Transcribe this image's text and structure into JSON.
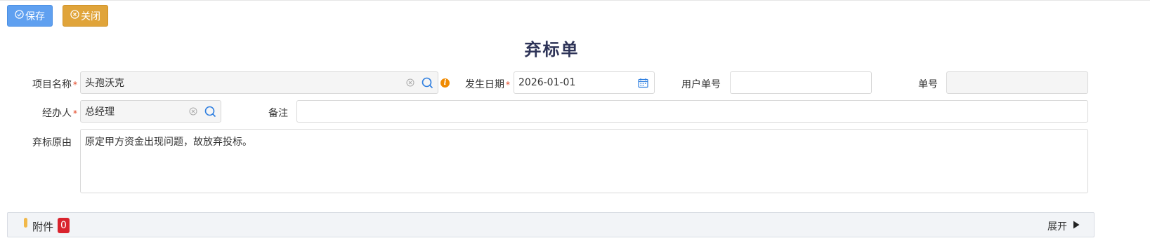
{
  "toolbar": {
    "save_label": "保存",
    "close_label": "关闭"
  },
  "form": {
    "title": "弃标单",
    "project_name": {
      "label": "项目名称",
      "value": "头孢沃克"
    },
    "occur_date": {
      "label": "发生日期",
      "value": "2026-01-01"
    },
    "user_no": {
      "label": "用户单号",
      "value": ""
    },
    "order_no": {
      "label": "单号",
      "value": ""
    },
    "handler": {
      "label": "经办人",
      "value": "总经理"
    },
    "remark": {
      "label": "备注",
      "value": ""
    },
    "reason": {
      "label": "弃标原由",
      "value": "原定甲方资金出现问题，故放弃投标。"
    },
    "required_mark": "*"
  },
  "attachments": {
    "label": "附件",
    "count": "0",
    "expand_label": "展开"
  },
  "colors": {
    "save_button": "#5fa0f0",
    "close_button": "#e0a43a",
    "title": "#2e3458",
    "required": "#e2421f",
    "badge": "#d9232d"
  },
  "icons": [
    "check-circle-icon",
    "close-circle-icon",
    "clear-icon",
    "search-icon",
    "info-icon",
    "calendar-icon",
    "triangle-right-icon"
  ]
}
